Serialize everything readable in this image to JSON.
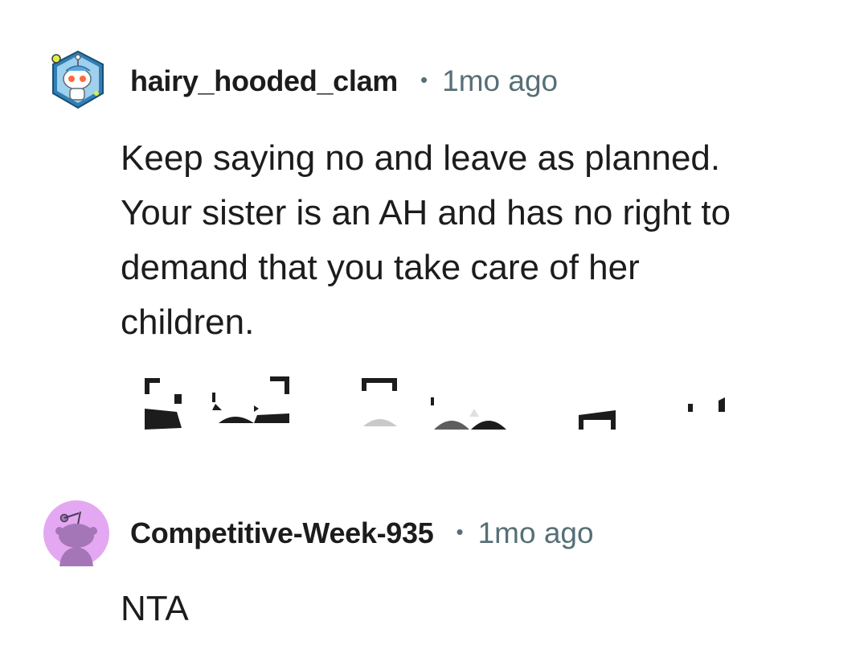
{
  "comments": [
    {
      "username": "hairy_hooded_clam",
      "separator": "•",
      "time": "1mo ago",
      "body": "Keep saying no and leave as planned.\nYour sister is an AH and has no right to\ndemand that you take care of her\nchildren."
    },
    {
      "username": "Competitive-Week-935",
      "separator": "•",
      "time": "1mo ago",
      "body": "NTA"
    }
  ],
  "icons": {
    "avatar_1": "snoo-avatar-icon",
    "avatar_2": "default-snoo-avatar-icon"
  },
  "colors": {
    "text": "#1c1c1c",
    "meta": "#576f76",
    "avatar2_bg": "#e4a8f2",
    "avatar2_snoo": "#a476b7"
  }
}
